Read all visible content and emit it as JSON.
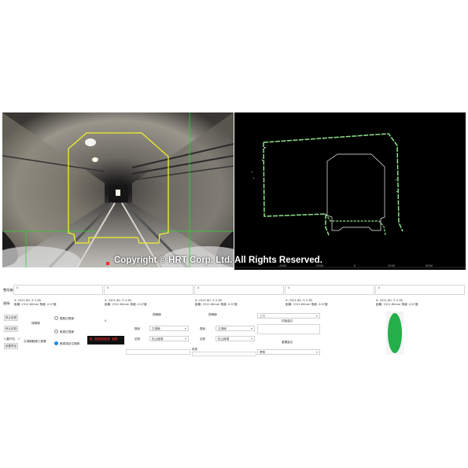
{
  "watermark": "Copyright © HRT Corp. Ltd. All Rights Reserved.",
  "plot_ticks": [
    "-4000",
    "-2000",
    "0",
    "2000",
    "4000"
  ],
  "row_labels": {
    "delta": "整段偏差",
    "points": "邊緣"
  },
  "columns": [
    {
      "value": "0",
      "info1": "X: 2311.60, Y: 2.85",
      "info2": "距離: 2311.60mm 角度: 0.07度"
    },
    {
      "value": "0",
      "info1": "X: 2311.60, Y: 2.85",
      "info2": "距離: 2311.60mm 角度: 0.07度"
    },
    {
      "value": "0",
      "info1": "X: 2311.60, Y: 2.85",
      "info2": "距離: 2311.60mm 角度: 0.07度"
    },
    {
      "value": "0",
      "info1": "X: 2311.60, Y: 2.85",
      "info2": "距離: 2311.60mm 角度: 0.07度"
    },
    {
      "value": "0",
      "info1": "X: 2311.60, Y: 2.85",
      "info2": "距離: 2311.60mm 角度: 0.07度"
    }
  ],
  "controls": {
    "btn_pause": "停止檢測",
    "btn_stop": "停止記錄",
    "btn_setting": "設置界定",
    "lbl_status": "搜尋場",
    "lbl_mode": "1.動作位",
    "lbl_source": "文湖線動線工程基",
    "radio1": "擬點位限線",
    "radio2": "數據位限線",
    "radio3": "數據項目位限線",
    "value_zero": "0",
    "counter": "0.000000 KM",
    "section_left": "搜尋線",
    "section_right": "搜尋線",
    "lbl_line": "路段",
    "lbl_station": "站別",
    "lbl_section": "段別",
    "drop_line_left": "文湖線",
    "drop_station_left": "松山機場",
    "drop_line_right": "文湖線",
    "drop_station_right": "松山機場",
    "drop_direction": "上行",
    "lbl_check_pos": "初始量位",
    "lbl_check_pos2": "重置量位",
    "drop_mode": "標準"
  },
  "colors": {
    "overlay_yellow": "#f2f12a",
    "overlay_green": "#2fd12f",
    "contour_green": "#8ee38a",
    "indicator_green": "#23b04a",
    "counter_red": "#ff2a2a"
  }
}
